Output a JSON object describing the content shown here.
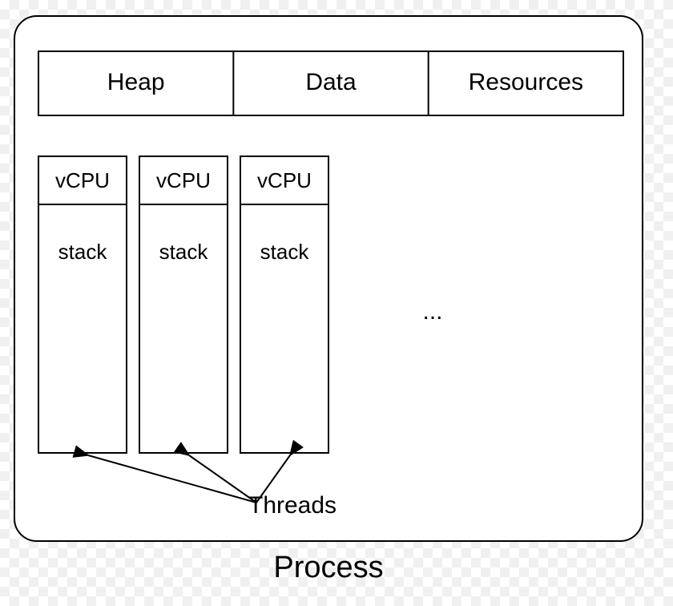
{
  "diagram": {
    "title": "Process",
    "top_row": {
      "cells": [
        "Heap",
        "Data",
        "Resources"
      ]
    },
    "threads": {
      "label": "Threads",
      "ellipsis": "...",
      "columns": [
        {
          "vcpu_label": "vCPU",
          "stack_label": "stack"
        },
        {
          "vcpu_label": "vCPU",
          "stack_label": "stack"
        },
        {
          "vcpu_label": "vCPU",
          "stack_label": "stack"
        }
      ]
    }
  }
}
